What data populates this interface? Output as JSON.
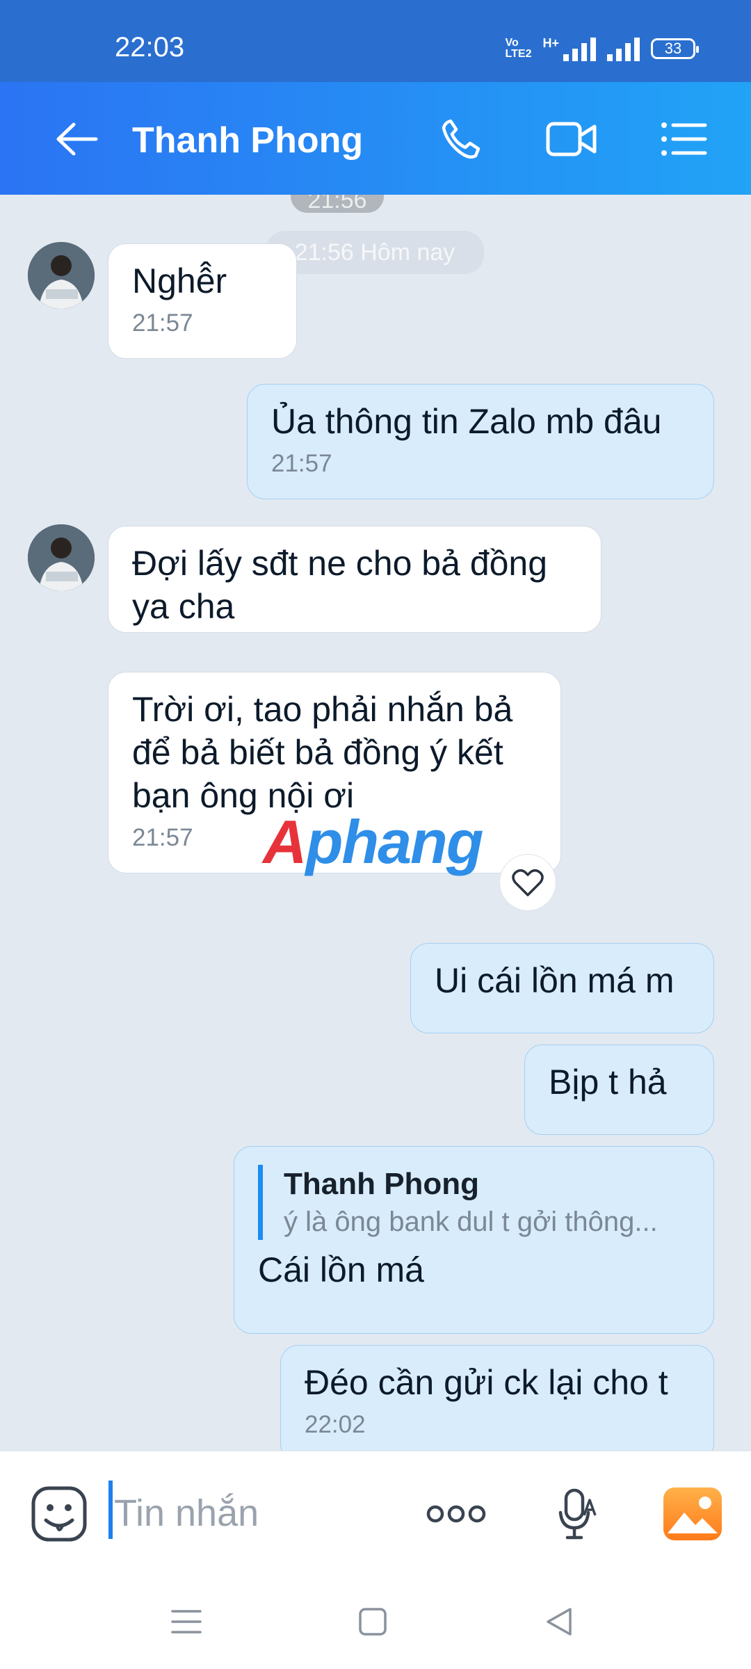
{
  "status_bar": {
    "time": "22:03",
    "volte_label": "Vo\nLTE2",
    "network_type": "H+",
    "battery": "33"
  },
  "header": {
    "contact_name": "Thanh Phong",
    "icons": [
      "back-arrow-icon",
      "phone-icon",
      "video-call-icon",
      "menu-list-icon"
    ]
  },
  "chat": {
    "pill_time": "21:56",
    "pill_date": "21:56 Hôm nay",
    "messages": [
      {
        "from": "them",
        "text": "Nghê̂r",
        "time": "21:57"
      },
      {
        "from": "me",
        "text": "Ủa thông tin Zalo mb đâu",
        "time": "21:57"
      },
      {
        "from": "them",
        "text": "Đợi lấy sđt ne cho bả đồng ya cha"
      },
      {
        "from": "them",
        "text": "Trời ơi, tao phải nhắn bả để bả biết bả đồng ý kết bạn ông nội ơi",
        "time": "21:57"
      },
      {
        "from": "me",
        "text": "Ui cái lồn má m"
      },
      {
        "from": "me",
        "text": "Bịp t hả"
      },
      {
        "from": "me",
        "quote": {
          "name": "Thanh Phong",
          "text": "ý là ông bank dul t gởi thông..."
        },
        "text": "Cái lồn má"
      },
      {
        "from": "me",
        "text": "Đéo cần gửi ck lại cho t",
        "time": "22:02"
      }
    ],
    "watermark": {
      "part1": "A",
      "part2": "phang"
    }
  },
  "input": {
    "placeholder": "Tin nhắn",
    "icons": [
      "emoji-icon",
      "more-options-icon",
      "voice-to-text-icon",
      "image-gallery-icon"
    ]
  },
  "colors": {
    "header_start": "#2b74f3",
    "header_end": "#21a3f6",
    "chat_bg": "#e2e9f1",
    "bubble_out": "#d8ecfc",
    "bubble_in": "#ffffff",
    "accent": "#1d7ff0"
  }
}
